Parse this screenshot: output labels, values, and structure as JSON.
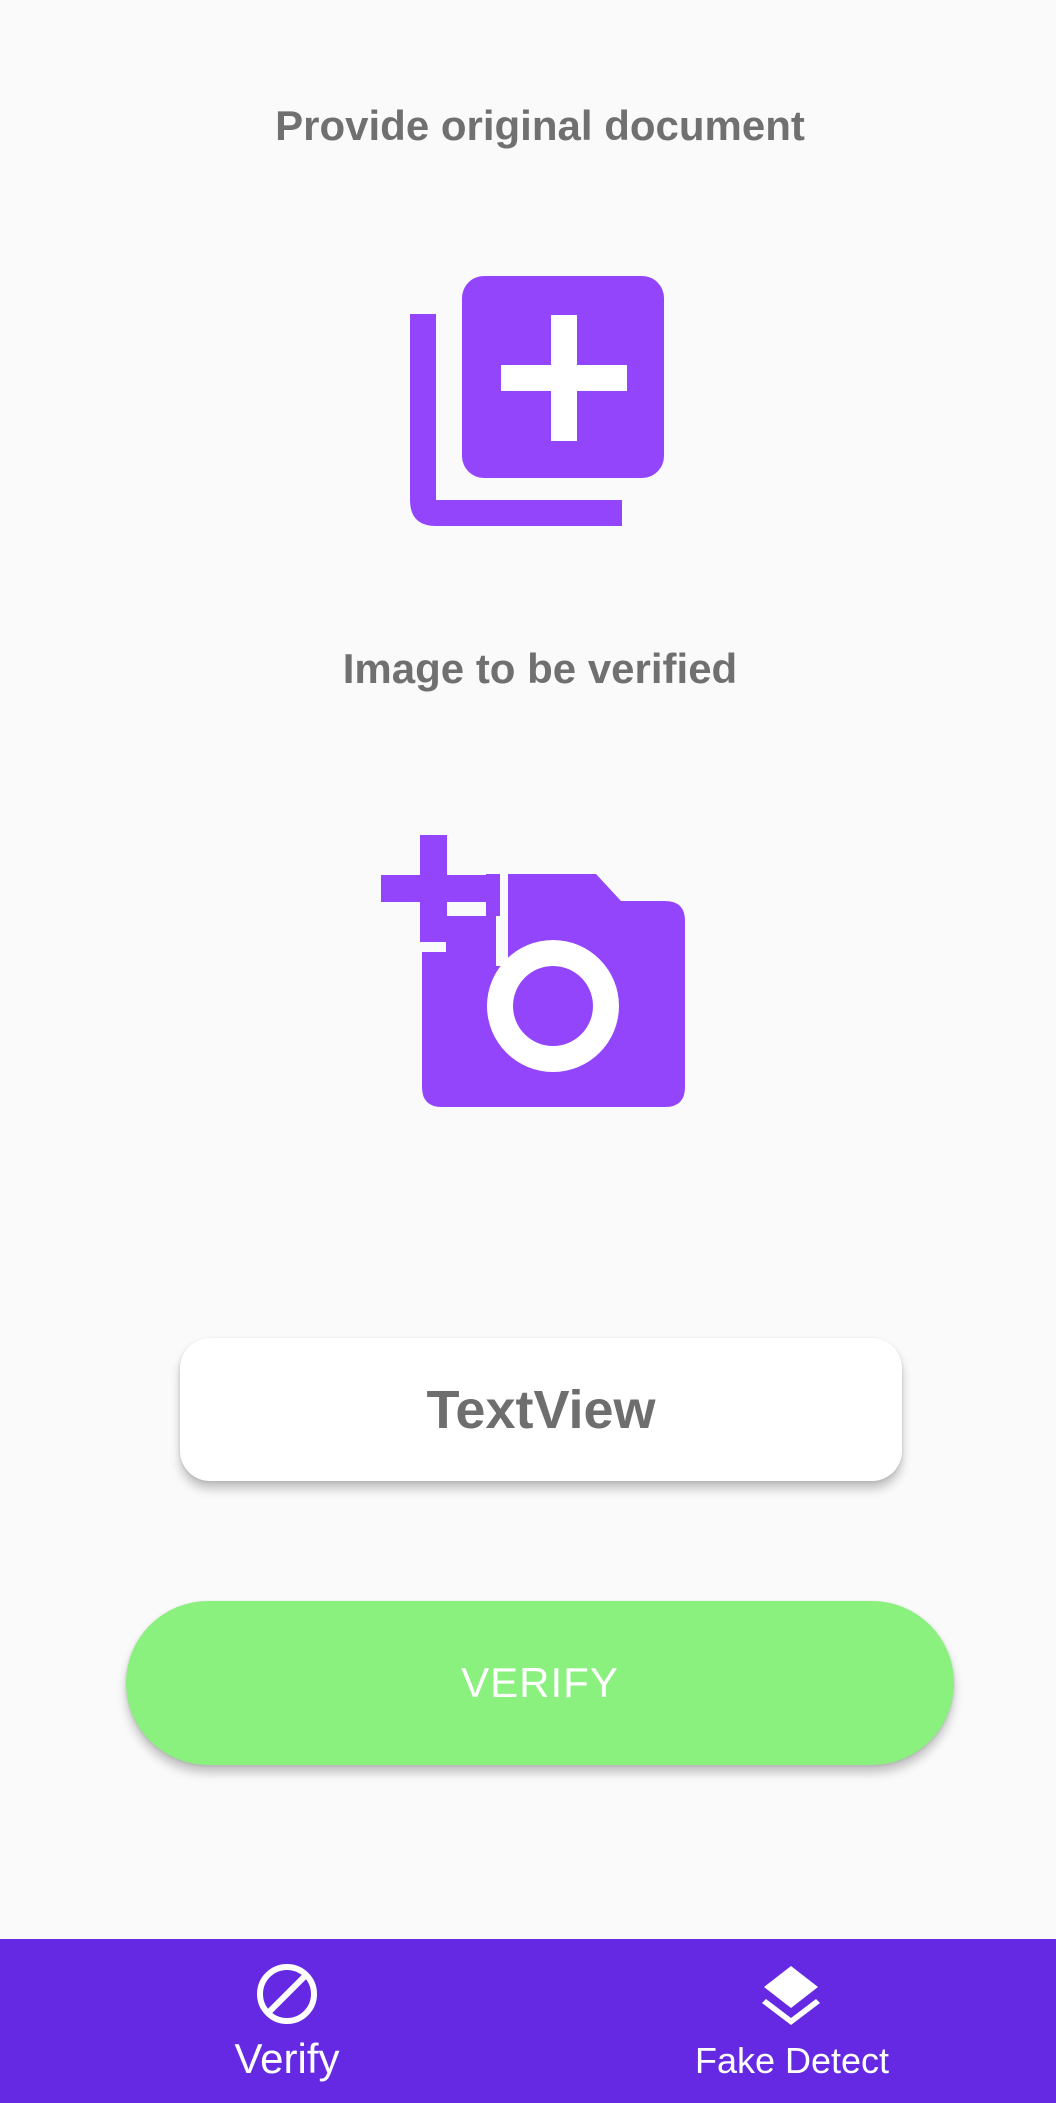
{
  "header": {
    "original_title": "Provide original document",
    "verify_title": "Image to be verified"
  },
  "icons": {
    "add_document": "add-photo-alternate-icon",
    "add_camera": "add-a-photo-icon",
    "nav_verify": "block-icon",
    "nav_fake_detect": "layers-icon"
  },
  "result": {
    "text": "TextView"
  },
  "actions": {
    "verify_label": "VERIFY"
  },
  "bottom_nav": {
    "items": [
      {
        "label": "Verify"
      },
      {
        "label": "Fake Detect"
      }
    ]
  },
  "colors": {
    "accent": "#9345fc",
    "nav_background": "#6629e3",
    "verify_button": "#8af07e",
    "heading_text": "#707070",
    "background": "#fafafa"
  }
}
